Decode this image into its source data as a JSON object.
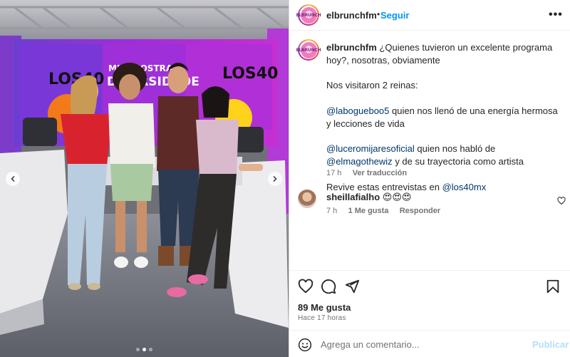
{
  "post": {
    "username": "elbrunchfm",
    "separator": "•",
    "follow_label": "Seguir",
    "more_label": "•••",
    "avatar_logo_text": "ELBRUNCH"
  },
  "media": {
    "studio_sign_left": "LOS40",
    "studio_sign_center_line1": "MUY NOSTRA",
    "studio_sign_center_line2": "DIVERSIDADE",
    "studio_sign_right": "LOS40",
    "carousel_slides": 3,
    "carousel_active_index": 1
  },
  "caption": {
    "username": "elbrunchfm",
    "line1": "¿Quienes tuvieron un excelente programa hoy?, nosotras, obviamente",
    "line2": "Nos visitaron 2 reinas:",
    "mention1": "@labogueboo5",
    "line3_rest": "quien nos llenó de una energía hermosa y lecciones de vida",
    "mention2": "@luceromijaresoficial",
    "line4_mid": "quien nos habló de",
    "mention3": "@elmagothewiz",
    "line4_rest": "y de su trayectoria como artista",
    "line5": "Revive estas entrevistas en",
    "mention4": "@los40mx",
    "time": "17 h",
    "see_translation": "Ver traducción"
  },
  "comment": {
    "username": "sheillafialho",
    "text": "😍😍😍",
    "time": "7 h",
    "likes": "1 Me gusta",
    "reply": "Responder"
  },
  "actions": {
    "likes_count": "89 Me gusta",
    "posted_time": "Hace 17 horas"
  },
  "composer": {
    "placeholder": "Agrega un comentario...",
    "publish_label": "Publicar"
  },
  "colors": {
    "accent": "#0095f6",
    "mention": "#00376b",
    "muted": "#737373",
    "publish_disabled": "#b2dffc"
  }
}
